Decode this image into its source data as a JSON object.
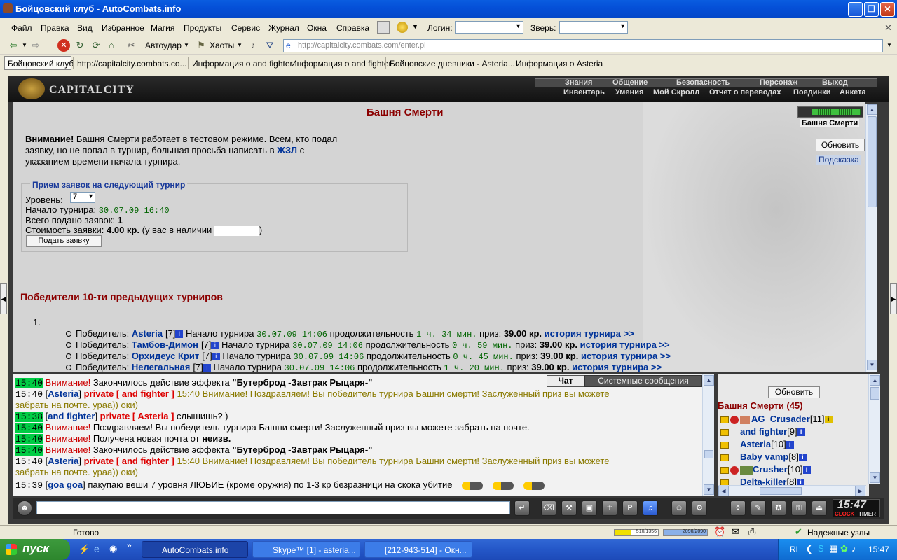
{
  "window": {
    "title": "Бойцовский клуб - AutoCombats.info"
  },
  "menu": [
    "Файл",
    "Правка",
    "Вид",
    "Избранное",
    "Магия",
    "Продукты",
    "Сервис",
    "Журнал",
    "Окна",
    "Справка"
  ],
  "menu_extra": {
    "login_label": "Логин:",
    "beast_label": "Зверь:"
  },
  "toolbar": {
    "autoudar": "Автоудар",
    "haoty": "Хаоты",
    "address": "http://capitalcity.combats.com/enter.pl"
  },
  "links": [
    "Бойцовский клуб",
    "http://capitalcity.combats.co...",
    "Информация о and fighter",
    "Информация о and fighter",
    "Бойцовские дневники - Asteria...",
    "Информация о Asteria"
  ],
  "game": {
    "logo": "CAPITALCITY",
    "nav_top": [
      "Знания",
      "Общение",
      "Безопасность",
      "Персонаж",
      "Выход"
    ],
    "nav_bottom": [
      "Инвентарь",
      "Умения",
      "Мой Скролл",
      "Отчет о переводах",
      "Поединки",
      "Анкета"
    ],
    "location_label": "Башня Смерти",
    "refresh_button": "Обновить",
    "hint_link": "Подсказка",
    "page_title": "Башня Смерти",
    "notice_bold": "Внимание!",
    "notice_line1": " Башня Смерти работает в тестовом режиме. Всем, кто подал",
    "notice_line2_pre": "заявку, но не попал в турнир, большая просьба написать в ",
    "notice_line2_link": "ЖЗЛ",
    "notice_line2_post": " с",
    "notice_line3": "указанием времени начала турнира.",
    "apply": {
      "legend": "Прием заявок на следующий турнир",
      "level_label": "Уровень:",
      "level_value": "7",
      "start_label": "Начало турнира: ",
      "start_value": "30.07.09 16:40",
      "total_label": "Всего подано заявок: ",
      "total_value": "1",
      "cost_label": "Стоимость заявки: ",
      "cost_value": "4.00 кр.",
      "cost_suffix_pre": " (у вас в наличии ",
      "cost_suffix_post": ")",
      "submit": "Подать заявку"
    },
    "winners_title": "Победители 10-ти предыдущих турниров",
    "list_number": "1.",
    "winners": [
      {
        "label": "Победитель: ",
        "name": "Asteria",
        "level": "[7]",
        "start_label": " Начало турнира ",
        "start": "30.07.09 14:06",
        "dur_label": " продолжительность ",
        "dur": "1 ч. 34 мин.",
        "prize_label": " приз: ",
        "prize": "39.00 кр.",
        "history": "история турнира >>"
      },
      {
        "label": "Победитель: ",
        "name": "Тамбов-Димон",
        "level": "[7]",
        "start_label": " Начало турнира ",
        "start": "30.07.09 14:06",
        "dur_label": " продолжительность ",
        "dur": "0 ч. 59 мин.",
        "prize_label": " приз: ",
        "prize": "39.00 кр.",
        "history": "история турнира >>"
      },
      {
        "label": "Победитель: ",
        "name": "Орхидеус Крит",
        "level": "[7]",
        "start_label": " Начало турнира ",
        "start": "30.07.09 14:06",
        "dur_label": " продолжительность ",
        "dur": "0 ч. 45 мин.",
        "prize_label": " приз: ",
        "prize": "39.00 кр.",
        "history": "история турнира >>"
      },
      {
        "label": "Победитель: ",
        "name": "Нелегальная",
        "level": "[7]",
        "start_label": " Начало турнира ",
        "start": "30.07.09 14:06",
        "dur_label": " продолжительность ",
        "dur": "1 ч. 20 мин.",
        "prize_label": " приз: ",
        "prize": "39.00 кр.",
        "history": "история турнира >>"
      }
    ]
  },
  "chat": {
    "tabs": [
      "Чат",
      "Системные сообщения"
    ],
    "lines": [
      {
        "time": "15:40",
        "hl": true,
        "parts": [
          {
            "t": "Внимание!",
            "c": "red"
          },
          {
            "t": " Закончилось действие эффекта "
          },
          {
            "t": "\"Бутерброд -Завтрак Рыцаря-\"",
            "b": true
          }
        ]
      },
      {
        "time": "15:40",
        "hl": false,
        "parts": [
          {
            "t": "[",
            "c": ""
          },
          {
            "t": "Asteria",
            "c": "blue"
          },
          {
            "t": "] "
          },
          {
            "t": "private [ and fighter ]",
            "c": "pvt"
          },
          {
            "t": " 15:40 Внимание! Поздравляем! Вы победитель турнира Башни смерти! Заслуженный приз вы можете",
            "c": "olive"
          }
        ]
      },
      {
        "time": "",
        "hl": false,
        "parts": [
          {
            "t": "забрать на почте. ураа)) оки)",
            "c": "olive"
          }
        ]
      },
      {
        "time": "15:38",
        "hl": true,
        "parts": [
          {
            "t": "["
          },
          {
            "t": "and fighter",
            "c": "blue"
          },
          {
            "t": "] "
          },
          {
            "t": "private [ Asteria ]",
            "c": "pvt"
          },
          {
            "t": " слышишь? )"
          }
        ]
      },
      {
        "time": "15:40",
        "hl": true,
        "parts": [
          {
            "t": "Внимание!",
            "c": "red"
          },
          {
            "t": " Поздравляем! Вы победитель турнира Башни смерти! Заслуженный приз вы можете забрать на почте."
          }
        ]
      },
      {
        "time": "15:40",
        "hl": true,
        "parts": [
          {
            "t": "Внимание!",
            "c": "red"
          },
          {
            "t": " Получена новая почта от "
          },
          {
            "t": "неизв.",
            "b": true
          }
        ]
      },
      {
        "time": "15:40",
        "hl": true,
        "parts": [
          {
            "t": "Внимание!",
            "c": "red"
          },
          {
            "t": " Закончилось действие эффекта "
          },
          {
            "t": "\"Бутерброд -Завтрак Рыцаря-\"",
            "b": true
          }
        ]
      },
      {
        "time": "15:40",
        "hl": false,
        "parts": [
          {
            "t": "["
          },
          {
            "t": "Asteria",
            "c": "blue"
          },
          {
            "t": "] "
          },
          {
            "t": "private [ and fighter ]",
            "c": "pvt"
          },
          {
            "t": " 15:40 Внимание! Поздравляем! Вы победитель турнира Башни смерти! Заслуженный приз вы можете",
            "c": "olive"
          }
        ]
      },
      {
        "time": "",
        "hl": false,
        "parts": [
          {
            "t": "забрать на почте. ураа)) оки)",
            "c": "olive"
          }
        ]
      },
      {
        "time": "15:39",
        "hl": false,
        "parts": [
          {
            "t": "["
          },
          {
            "t": "goa goa",
            "c": "blue"
          },
          {
            "t": "] пакупаю веши 7 уровня ЛЮБИЕ (кроме оружия) по 1-3 кр безразници на скока убитие"
          }
        ]
      }
    ]
  },
  "userlist": {
    "refresh": "Обновить",
    "room": "Башня Смерти (45)",
    "users": [
      {
        "name": "AG_Crusader",
        "level": "[11]"
      },
      {
        "name": "and fighter",
        "level": "[9]"
      },
      {
        "name": "Asteria",
        "level": "[10]"
      },
      {
        "name": "Baby vamp",
        "level": "[8]"
      },
      {
        "name": "Crusher",
        "level": "[10]"
      },
      {
        "name": "Delta-killer",
        "level": "[8]"
      }
    ]
  },
  "clock": {
    "time": "15:47",
    "caption_clock": "CLOCK",
    "caption_timer": "TIMER"
  },
  "statusbar": {
    "text": "Готово",
    "hp": "510/1356",
    "mana": "2090/2090",
    "zone": "Надежные узлы"
  },
  "taskbar": {
    "start": "пуск",
    "tasks": [
      "AutoCombats.info",
      "Skype™ [1] - asteria...",
      "[212-943-514] - Окн..."
    ],
    "lang": "RL",
    "time": "15:47"
  },
  "colors": {
    "xp_blue": "#0550d8",
    "game_bg": "#d4d4d4",
    "title_red": "#8b0000",
    "link_blue": "#003399",
    "chat_highlight": "#00cc44"
  }
}
